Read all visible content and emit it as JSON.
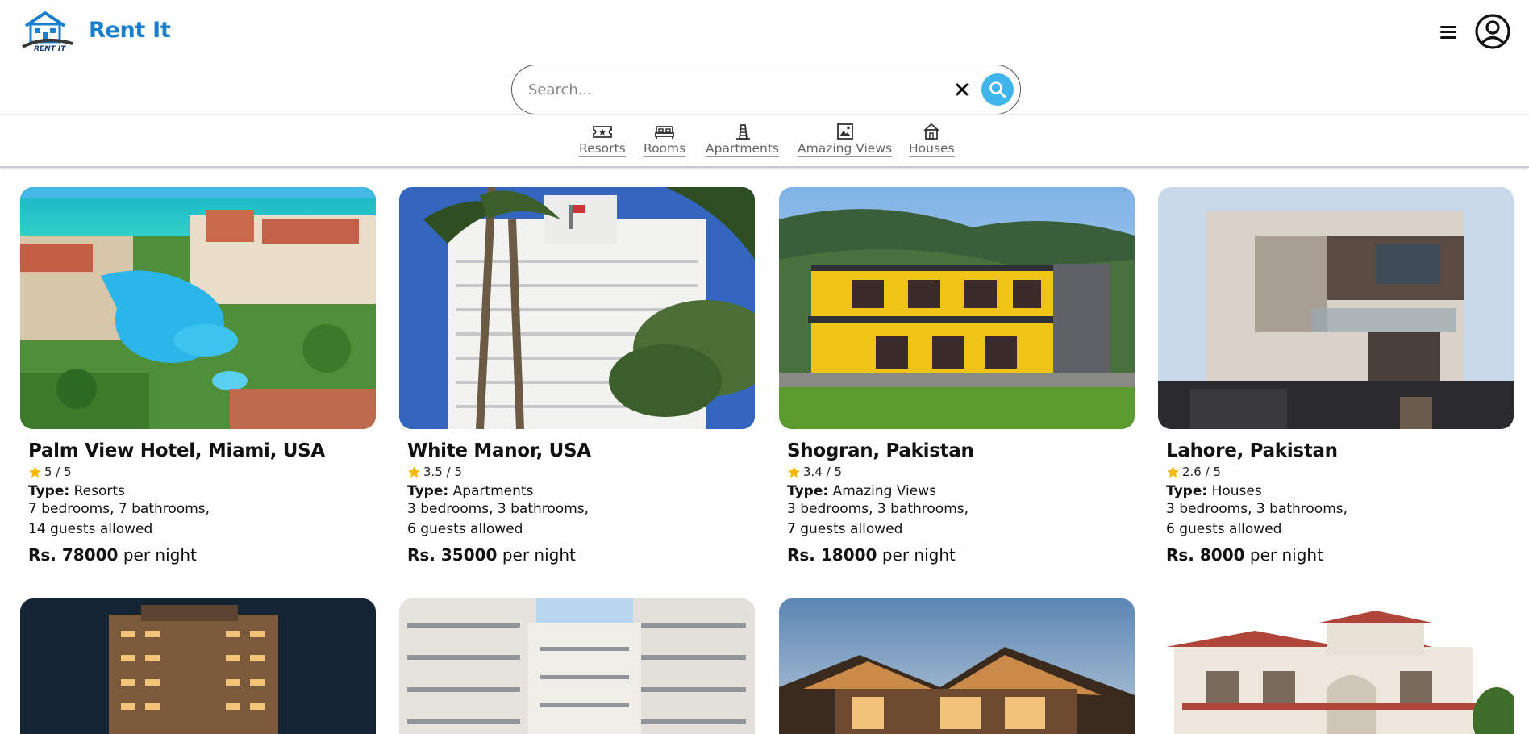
{
  "app": {
    "brand": "Rent It"
  },
  "search": {
    "placeholder": "Search..."
  },
  "categories": [
    {
      "label": "Resorts",
      "icon": "ticket-icon"
    },
    {
      "label": "Rooms",
      "icon": "bed-icon"
    },
    {
      "label": "Apartments",
      "icon": "tower-icon"
    },
    {
      "label": "Amazing Views",
      "icon": "mountain-frame-icon"
    },
    {
      "label": "Houses",
      "icon": "house-icon"
    }
  ],
  "listings": [
    {
      "title": "Palm View Hotel, Miami, USA",
      "rating": "5 / 5",
      "type_label": "Type:",
      "type": "Resorts",
      "rooms": "7 bedrooms, 7 bathrooms,",
      "guests": "14 guests allowed",
      "price": "Rs. 78000",
      "price_suffix": "per night"
    },
    {
      "title": "White Manor, USA",
      "rating": "3.5 / 5",
      "type_label": "Type:",
      "type": "Apartments",
      "rooms": "3 bedrooms, 3 bathrooms,",
      "guests": "6 guests allowed",
      "price": "Rs. 35000",
      "price_suffix": "per night"
    },
    {
      "title": "Shogran, Pakistan",
      "rating": "3.4 / 5",
      "type_label": "Type:",
      "type": "Amazing Views",
      "rooms": "3 bedrooms, 3 bathrooms,",
      "guests": "7 guests allowed",
      "price": "Rs. 18000",
      "price_suffix": "per night"
    },
    {
      "title": "Lahore, Pakistan",
      "rating": "2.6 / 5",
      "type_label": "Type:",
      "type": "Houses",
      "rooms": "3 bedrooms, 3 bathrooms,",
      "guests": "6 guests allowed",
      "price": "Rs. 8000",
      "price_suffix": "per night"
    }
  ],
  "colors": {
    "brand": "#1a7fcf",
    "search_button": "#3fb5ec",
    "star": "#f5b800"
  }
}
